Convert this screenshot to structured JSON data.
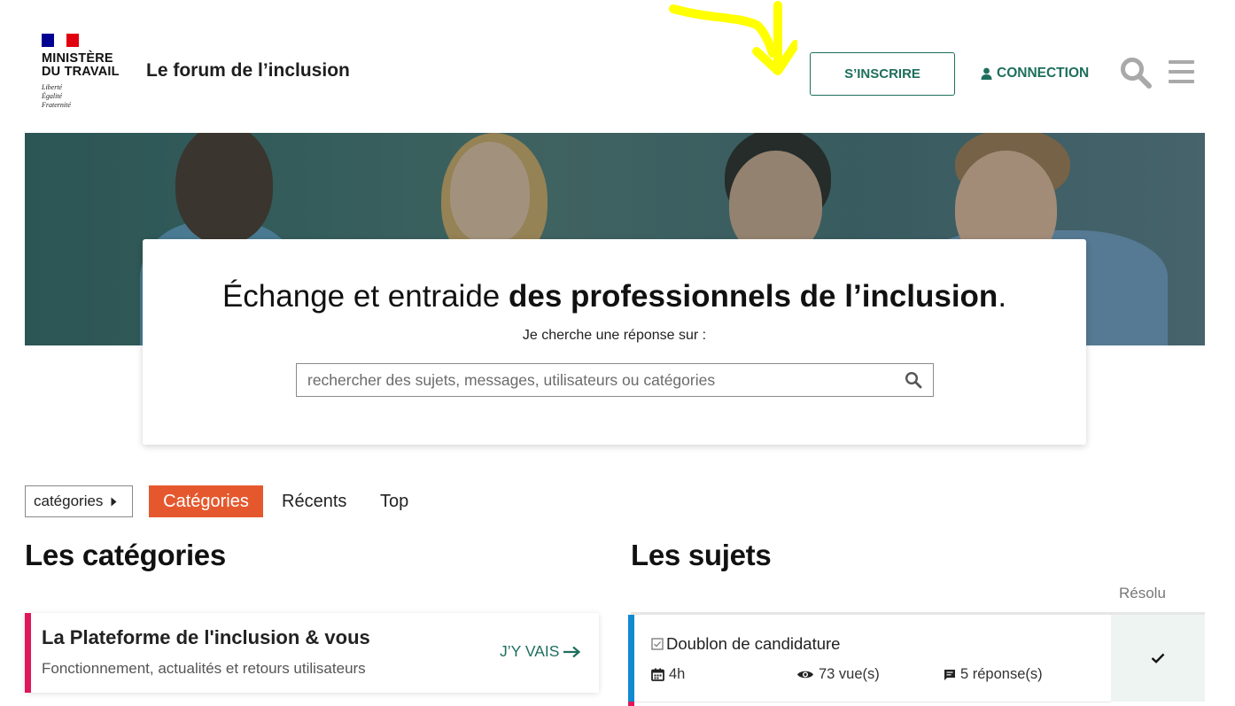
{
  "header": {
    "ministry_line1": "MINISTÈRE",
    "ministry_line2": "DU TRAVAIL",
    "devise": [
      "Liberté",
      "Égalité",
      "Fraternité"
    ],
    "site_title": "Le forum de l’inclusion",
    "signup_label": "S’INSCRIRE",
    "login_label": "CONNECTION",
    "icons": {
      "search": "search-icon",
      "menu": "hamburger-menu-icon",
      "user": "user-icon"
    }
  },
  "hero": {
    "title_plain": "Échange et entraide ",
    "title_bold": "des professionnels de l’inclusion",
    "title_end": ".",
    "subtitle": "Je cherche une réponse sur :",
    "search_placeholder": "rechercher des sujets, messages, utilisateurs ou catégories"
  },
  "nav": {
    "dropdown_label": "catégories",
    "tabs": [
      {
        "label": "Catégories",
        "active": true
      },
      {
        "label": "Récents",
        "active": false
      },
      {
        "label": "Top",
        "active": false
      }
    ]
  },
  "categories_section": {
    "title": "Les catégories",
    "items": [
      {
        "name": "La Plateforme de l'inclusion & vous",
        "description": "Fonctionnement, actualités et retours utilisateurs",
        "link_label": "J’Y VAIS",
        "color": "#e0175a"
      }
    ]
  },
  "topics_section": {
    "title": "Les sujets",
    "resolved_header": "Résolu",
    "items": [
      {
        "title": "Doublon de candidature",
        "age": "4h",
        "views": "73 vue(s)",
        "replies": "5 réponse(s)",
        "resolved": true,
        "category_color": "#0f8ad0"
      }
    ]
  },
  "colors": {
    "accent_green": "#1d6f5c",
    "tab_active": "#e5582e",
    "flag_blue": "#000091",
    "flag_red": "#e1000f",
    "annotation_yellow": "#ffff00"
  }
}
